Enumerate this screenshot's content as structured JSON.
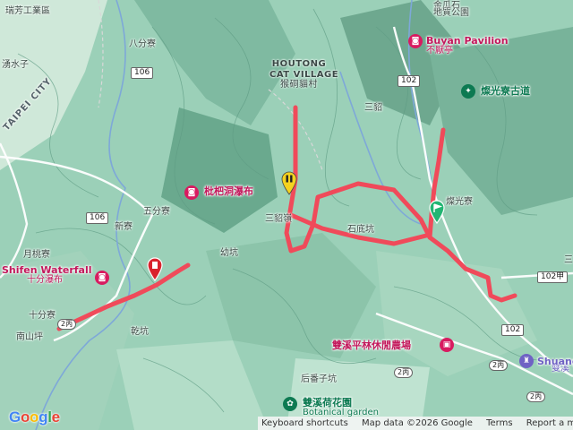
{
  "map": {
    "place_labels": {
      "ruifang": "瑞芳工業區",
      "bafenliao": "八分寮",
      "jinguashi_park": "金瓜石",
      "dizhi_park": "地質公園",
      "waterside": "湧水子",
      "sandiaoling": "三貂",
      "wufenliao": "五分寮",
      "xinliao": "新寮",
      "sanjiao": "三貂嶺",
      "youkeng": "幼坑",
      "hengkeng": "石底坑",
      "canguang": "燦光寮",
      "yuetaoliao": "月桃寮",
      "shifenliao": "十分寮",
      "qiankeng": "乾坑",
      "nanshanping": "南山坪",
      "houfanzikeng": "后番子坑",
      "shuangxi_area": "雙溪",
      "san": "三"
    },
    "area_edge_label": "TAIPEI CITY",
    "houtong": {
      "en": "HOUTONG\nCAT VILLAGE",
      "zh": "猴硐貓村"
    },
    "pois": {
      "buyan": {
        "en": "Buyan Pavilion",
        "zh": "不厭亭",
        "icon": "camera-icon",
        "color": "#d81b60"
      },
      "canguang_trail": {
        "zh": "燦光寮古道",
        "icon": "hiker-icon",
        "color": "#0d7a52"
      },
      "pipa_falls": {
        "zh": "枇杷洞瀑布",
        "icon": "camera-icon",
        "color": "#d81b60"
      },
      "shifen_falls": {
        "en": "Shifen Waterfall",
        "zh": "十分瀑布",
        "icon": "camera-icon",
        "color": "#d81b60"
      },
      "farm": {
        "zh": "雙溪平林休閒農場",
        "icon": "farm-icon",
        "color": "#d81b60"
      },
      "lotus": {
        "zh": "雙溪荷花園",
        "en": "Botanical garden",
        "icon": "flower-icon",
        "color": "#0d7a52"
      },
      "shuangxi": {
        "en": "Shuangxi",
        "icon": "castle-icon",
        "color": "#6f62c4"
      }
    },
    "road_shields": [
      "106",
      "106",
      "102",
      "102",
      "102甲",
      "2丙",
      "2丙",
      "2丙",
      "2丙"
    ],
    "markers": {
      "start": {
        "icon": "green-flag-marker",
        "color": "#22b573"
      },
      "end": {
        "icon": "red-pin-marker",
        "color": "#d9232d"
      },
      "waypoint": {
        "icon": "yellow-pause-marker",
        "color": "#f4d21f"
      }
    },
    "track_color": "#f04a5a"
  },
  "attribution": {
    "shortcuts": "Keyboard shortcuts",
    "map_data": "Map data ©2026 Google",
    "terms": "Terms",
    "report": "Report a map error"
  },
  "logo": {
    "g1": "G",
    "o1": "o",
    "o2": "o",
    "g2": "g",
    "l": "l",
    "e": "e"
  }
}
